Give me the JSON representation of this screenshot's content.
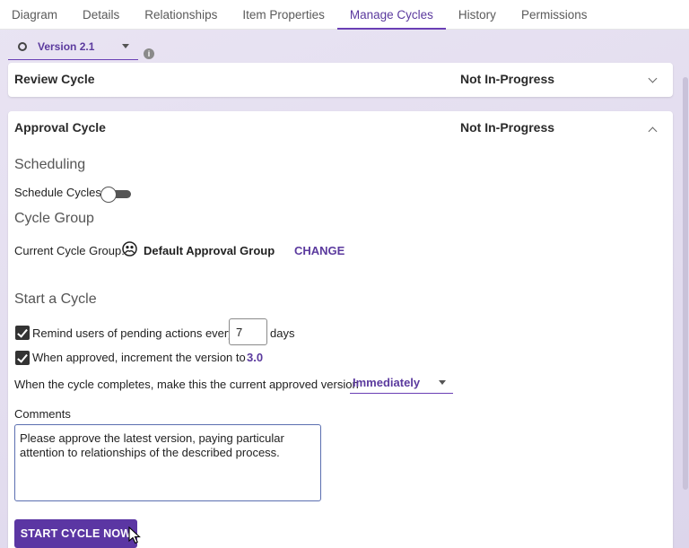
{
  "tabs": [
    {
      "label": "Diagram"
    },
    {
      "label": "Details"
    },
    {
      "label": "Relationships"
    },
    {
      "label": "Item Properties"
    },
    {
      "label": "Manage Cycles"
    },
    {
      "label": "History"
    },
    {
      "label": "Permissions"
    }
  ],
  "active_tab": "Manage Cycles",
  "version_select": {
    "value": "Version 2.1",
    "info_glyph": "i"
  },
  "review_cycle": {
    "title": "Review Cycle",
    "status": "Not In-Progress"
  },
  "approval_cycle": {
    "title": "Approval Cycle",
    "status": "Not In-Progress",
    "scheduling": {
      "heading": "Scheduling",
      "schedule_label": "Schedule Cycles"
    },
    "cycle_group": {
      "heading": "Cycle Group",
      "label": "Current Cycle Group:",
      "value": "Default Approval Group",
      "change_link": "CHANGE"
    },
    "start": {
      "heading": "Start a Cycle",
      "remind_label": "Remind users of pending actions every",
      "remind_days": "7",
      "remind_unit": "days",
      "increment_label": "When approved, increment the version to",
      "increment_value": "3.0",
      "complete_label": "When the cycle completes, make this the current approved version",
      "complete_value": "Immediately",
      "comments_label": "Comments",
      "comments_value": "Please approve the latest version, paying particular attention to relationships of the described process.",
      "start_button": "START CYCLE NOW"
    }
  },
  "colors": {
    "accent": "#5b36a3",
    "accent_text": "#5b3a9e",
    "background": "#e6e0f1"
  }
}
